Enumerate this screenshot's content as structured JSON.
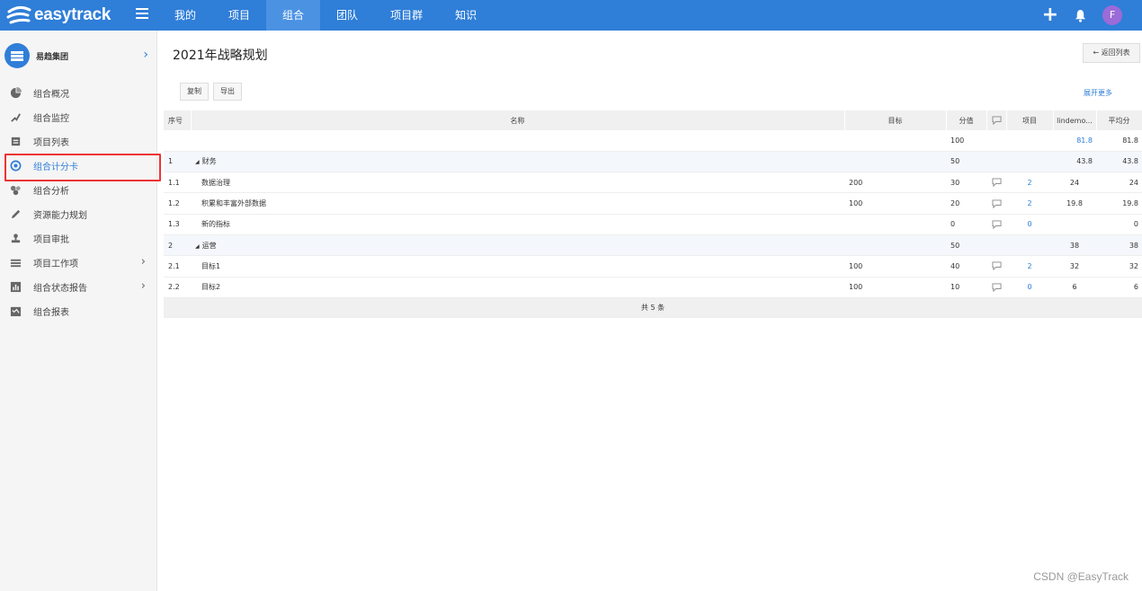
{
  "app": {
    "logo_text": "easytrack"
  },
  "nav": [
    "我的",
    "项目",
    "组合",
    "团队",
    "项目群",
    "知识"
  ],
  "user": {
    "avatar_letter": "F"
  },
  "sidebar": {
    "org_name": "易趋集团",
    "items": [
      {
        "label": "组合概况",
        "icon": "pie-chart-icon"
      },
      {
        "label": "组合监控",
        "icon": "monitor-icon"
      },
      {
        "label": "项目列表",
        "icon": "list-icon"
      },
      {
        "label": "组合计分卡",
        "icon": "target-icon"
      },
      {
        "label": "组合分析",
        "icon": "analysis-icon"
      },
      {
        "label": "资源能力规划",
        "icon": "pencil-icon"
      },
      {
        "label": "项目审批",
        "icon": "stamp-icon"
      },
      {
        "label": "项目工作项",
        "icon": "workitem-icon"
      },
      {
        "label": "组合状态报告",
        "icon": "report-icon"
      },
      {
        "label": "组合报表",
        "icon": "table-icon"
      }
    ]
  },
  "main": {
    "title": "2021年战略规划",
    "back_label": "返回列表",
    "copy_label": "复制",
    "export_label": "导出",
    "expand_label": "展开更多"
  },
  "table": {
    "headers": [
      "序号",
      "名称",
      "目标",
      "分值",
      "",
      "项目",
      "lindemo...",
      "平均分"
    ],
    "total": {
      "score": "100",
      "lindemo": "81.8",
      "avg": "81.8"
    },
    "rows": [
      {
        "no": "1",
        "name": "财务",
        "target": "",
        "score": "50",
        "projects": "",
        "lindemo": "43.8",
        "avg": "43.8",
        "group": true
      },
      {
        "no": "1.1",
        "name": "数据治理",
        "target": "200",
        "score": "30",
        "projects": "2",
        "lindemo": "24",
        "avg": "24",
        "group": false
      },
      {
        "no": "1.2",
        "name": "积累和丰富外部数据",
        "target": "100",
        "score": "20",
        "projects": "2",
        "lindemo": "19.8",
        "avg": "19.8",
        "group": false
      },
      {
        "no": "1.3",
        "name": "新的指标",
        "target": "",
        "score": "0",
        "projects": "0",
        "lindemo": "",
        "avg": "0",
        "group": false
      },
      {
        "no": "2",
        "name": "运营",
        "target": "",
        "score": "50",
        "projects": "",
        "lindemo": "38",
        "avg": "38",
        "group": true
      },
      {
        "no": "2.1",
        "name": "目标1",
        "target": "100",
        "score": "40",
        "projects": "2",
        "lindemo": "32",
        "avg": "32",
        "group": false
      },
      {
        "no": "2.2",
        "name": "目标2",
        "target": "100",
        "score": "10",
        "projects": "0",
        "lindemo": "6",
        "avg": "6",
        "group": false
      }
    ],
    "footer": "共 5 条"
  },
  "watermark": "CSDN @EasyTrack",
  "colors": {
    "primary": "#2f7ed8",
    "nav_active": "#4b92e3",
    "highlight_box": "#ee3333"
  }
}
